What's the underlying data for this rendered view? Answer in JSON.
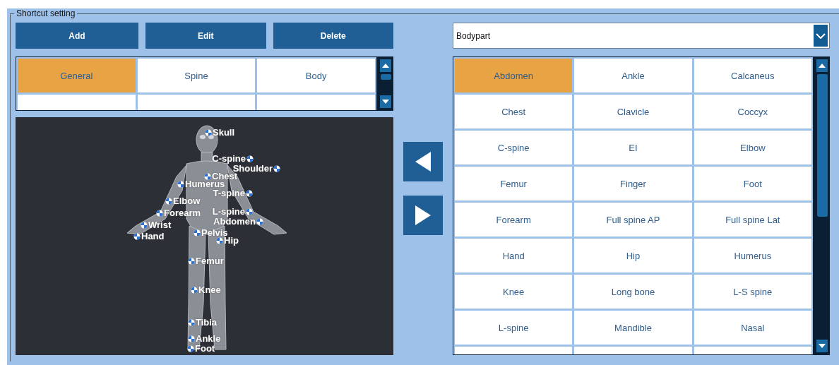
{
  "group": {
    "title": "Shortcut setting"
  },
  "buttons": [
    {
      "label": "Add"
    },
    {
      "label": "Edit"
    },
    {
      "label": "Delete"
    }
  ],
  "categories": [
    {
      "label": "General",
      "selected": true
    },
    {
      "label": "Spine",
      "selected": false
    },
    {
      "label": "Body",
      "selected": false
    }
  ],
  "body_map": {
    "labels": [
      "Skull",
      "C-spine",
      "Shoulder",
      "Chest",
      "Humerus",
      "T-spine",
      "Elbow",
      "Forearm",
      "L-spine",
      "Abdomen",
      "Wrist",
      "Hand",
      "Pelvis",
      "Hip",
      "Femur",
      "Knee",
      "Tibia",
      "Ankle",
      "Foot"
    ]
  },
  "dropdown": {
    "value": "Bodypart"
  },
  "bodyparts": [
    {
      "label": "Abdomen",
      "selected": true
    },
    {
      "label": "Ankle",
      "selected": false
    },
    {
      "label": "Calcaneus",
      "selected": false
    },
    {
      "label": "Chest",
      "selected": false
    },
    {
      "label": "Clavicle",
      "selected": false
    },
    {
      "label": "Coccyx",
      "selected": false
    },
    {
      "label": "C-spine",
      "selected": false
    },
    {
      "label": "EI",
      "selected": false
    },
    {
      "label": "Elbow",
      "selected": false
    },
    {
      "label": "Femur",
      "selected": false
    },
    {
      "label": "Finger",
      "selected": false
    },
    {
      "label": "Foot",
      "selected": false
    },
    {
      "label": "Forearm",
      "selected": false
    },
    {
      "label": "Full spine AP",
      "selected": false
    },
    {
      "label": "Full spine Lat",
      "selected": false
    },
    {
      "label": "Hand",
      "selected": false
    },
    {
      "label": "Hip",
      "selected": false
    },
    {
      "label": "Humerus",
      "selected": false
    },
    {
      "label": "Knee",
      "selected": false
    },
    {
      "label": "Long bone",
      "selected": false
    },
    {
      "label": "L-S spine",
      "selected": false
    },
    {
      "label": "L-spine",
      "selected": false
    },
    {
      "label": "Mandible",
      "selected": false
    },
    {
      "label": "Nasal",
      "selected": false
    }
  ]
}
